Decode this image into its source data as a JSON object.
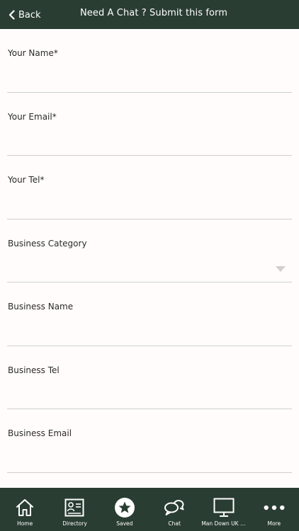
{
  "header": {
    "back_label": "Back",
    "title": "Need A Chat ? Submit this form"
  },
  "form": {
    "fields": [
      {
        "label": "Your Name*",
        "value": ""
      },
      {
        "label": "Your Email*",
        "value": ""
      },
      {
        "label": "Your Tel*",
        "value": ""
      },
      {
        "label": "Business Category",
        "value": ""
      },
      {
        "label": "Business Name",
        "value": ""
      },
      {
        "label": "Business Tel",
        "value": ""
      },
      {
        "label": "Business Email",
        "value": ""
      }
    ]
  },
  "tabbar": {
    "items": [
      {
        "label": "Home",
        "icon": "home-icon"
      },
      {
        "label": "Directory",
        "icon": "directory-icon"
      },
      {
        "label": "Saved",
        "icon": "star-icon"
      },
      {
        "label": "Chat",
        "icon": "chat-bubbles-icon"
      },
      {
        "label": "Man Down UK We...",
        "icon": "monitor-icon"
      },
      {
        "label": "More",
        "icon": "more-dots-icon"
      }
    ]
  },
  "colors": {
    "bar": "#2a3d32",
    "background": "#fffcfb",
    "divider": "#cfcfcf"
  }
}
